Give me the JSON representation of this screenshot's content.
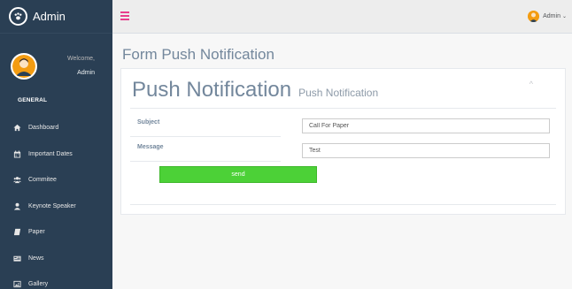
{
  "brand": {
    "title": "Admin",
    "icon": "paw-icon"
  },
  "profile": {
    "welcome": "Welcome,",
    "name": "Admin"
  },
  "sidebar": {
    "heading": "GENERAL",
    "items": [
      {
        "label": "Dashboard",
        "icon": "home-icon"
      },
      {
        "label": "Important Dates",
        "icon": "calendar-icon"
      },
      {
        "label": "Commitee",
        "icon": "users-icon"
      },
      {
        "label": "Keynote Speaker",
        "icon": "user-icon"
      },
      {
        "label": "Paper",
        "icon": "book-icon"
      },
      {
        "label": "News",
        "icon": "newspaper-icon"
      },
      {
        "label": "Gallery",
        "icon": "image-icon"
      }
    ]
  },
  "topbar": {
    "user_label": "Admin",
    "caret": "⌄"
  },
  "page": {
    "title": "Form Push Notification"
  },
  "panel": {
    "title": "Push Notification",
    "subtitle": "Push Notification",
    "collapse_glyph": "^"
  },
  "form": {
    "subject_label": "Subject",
    "subject_value": "Call For Paper",
    "message_label": "Message",
    "message_value": "Test",
    "send_label": "send"
  },
  "colors": {
    "sidebar": "#2a3f54",
    "accent_pink": "#e83e8c",
    "send_green": "#4cd137"
  }
}
